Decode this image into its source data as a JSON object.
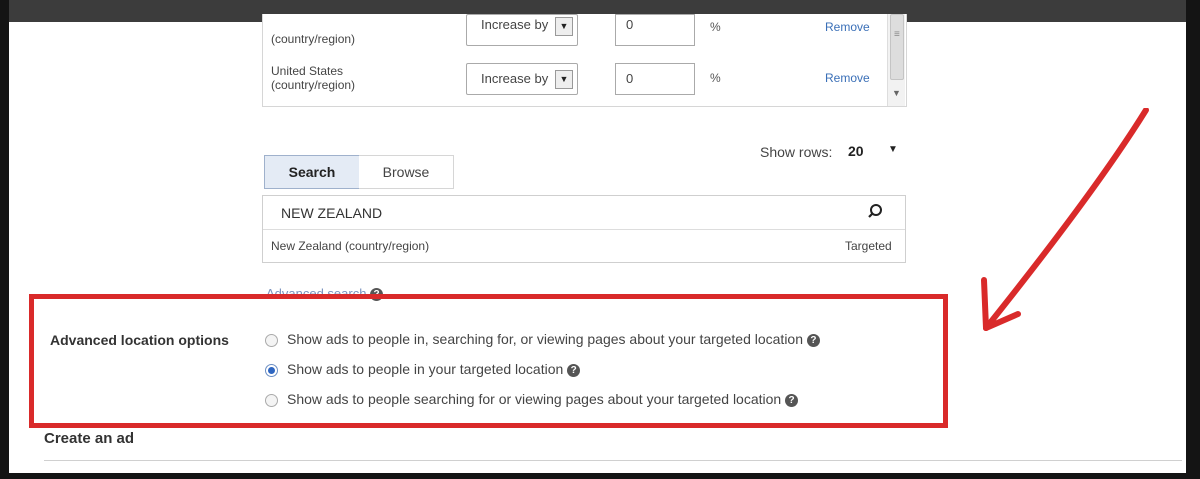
{
  "location_table": {
    "rows": [
      {
        "name": "(country/region)",
        "mode": "Increase by",
        "value": "0",
        "unit": "%",
        "action": "Remove"
      },
      {
        "name": "United States\n(country/region)",
        "mode": "Increase by",
        "value": "0",
        "unit": "%",
        "action": "Remove"
      }
    ],
    "show_rows_label": "Show rows:",
    "show_rows_value": "20"
  },
  "tabs": {
    "search": "Search",
    "browse": "Browse"
  },
  "search": {
    "query": "NEW ZEALAND",
    "result_name": "New Zealand (country/region)",
    "result_status": "Targeted"
  },
  "advanced_search_link": "Advanced search",
  "advanced_location": {
    "label": "Advanced location options",
    "options": [
      {
        "label": "Show ads to people in, searching for, or viewing pages about your targeted location",
        "selected": false
      },
      {
        "label": "Show ads to people in your targeted location",
        "selected": true
      },
      {
        "label": "Show ads to people searching for or viewing pages about your targeted location",
        "selected": false
      }
    ]
  },
  "create_ad": "Create an ad",
  "colors": {
    "highlight": "#d92a2a",
    "link": "#3a6fb7",
    "radio_selected": "#2e66c1"
  }
}
